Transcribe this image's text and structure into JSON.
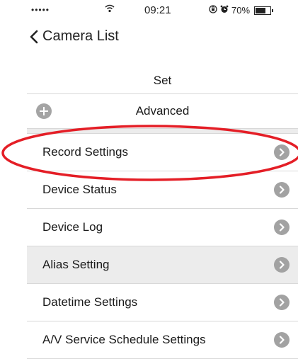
{
  "status_bar": {
    "signal": "•••••",
    "time": "09:21",
    "battery": "70%",
    "battery_level": 0.7
  },
  "nav": {
    "back_label": "Camera List"
  },
  "page": {
    "title": "Set"
  },
  "advanced": {
    "label": "Advanced"
  },
  "menu": {
    "items": [
      {
        "label": "Record Settings"
      },
      {
        "label": "Device Status"
      },
      {
        "label": "Device Log"
      },
      {
        "label": "Alias Setting"
      },
      {
        "label": "Datetime Settings"
      },
      {
        "label": "A/V Service Schedule Settings"
      }
    ]
  },
  "colors": {
    "highlight": "#e41e26",
    "chevron_bg": "#a2a2a2",
    "row_alt_bg": "#ececec"
  }
}
